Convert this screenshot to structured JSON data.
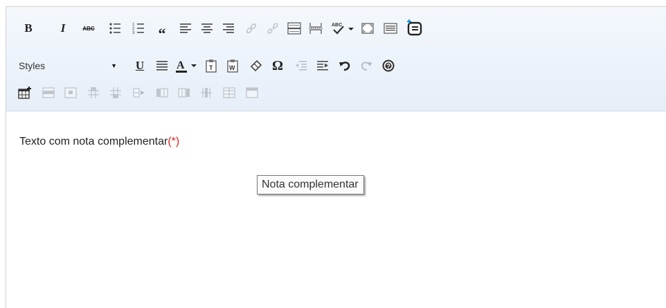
{
  "toolbar": {
    "styles_combo": {
      "value": "Styles"
    }
  },
  "editor": {
    "text": "Texto com nota complementar",
    "note_marker": "(*)",
    "tooltip": "Nota complementar"
  },
  "icons": {
    "row1": [
      "bold",
      "italic",
      "strikethrough",
      "bulleted-list",
      "numbered-list",
      "blockquote",
      "align-left",
      "align-center",
      "align-right",
      "link",
      "unlink",
      "horizontal-rule",
      "page-break",
      "spellcheck",
      "maximize",
      "show-blocks",
      "add-note"
    ],
    "row2": [
      "underline",
      "justify",
      "font-color",
      "paste-text",
      "paste-from-word",
      "remove-format",
      "special-char",
      "decrease-indent",
      "increase-indent",
      "undo",
      "redo",
      "help"
    ],
    "row3": [
      "insert-table",
      "table-row",
      "table-column",
      "table-header",
      "merge-cells",
      "insert-row-after",
      "insert-col-before",
      "insert-col-after",
      "delete-col",
      "delete-row",
      "delete-table"
    ]
  },
  "colors": {
    "toolbar_bg": "#eaf1fa",
    "note_marker": "#e02020",
    "add_note_accent": "#1a8fe0"
  }
}
